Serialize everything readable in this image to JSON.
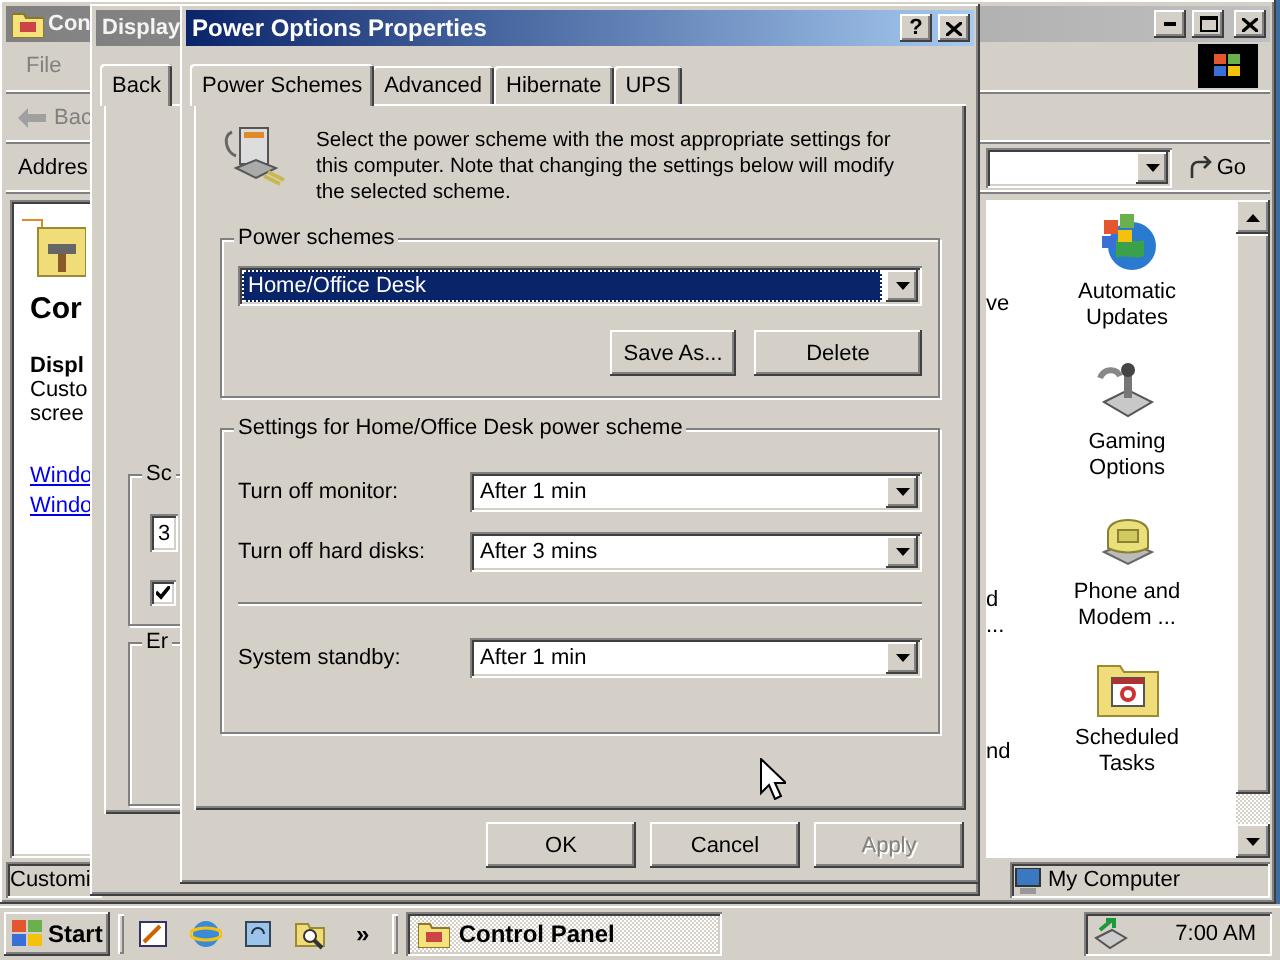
{
  "control_panel": {
    "title": "Con",
    "menu": [
      "File"
    ],
    "back": "Bac",
    "address_label": "Addres",
    "go": "Go",
    "heading": "Cor",
    "info_title": "Displ",
    "info_lines": [
      "Custo",
      "scree"
    ],
    "links": [
      "Windo",
      "Windo"
    ],
    "partial_labels": [
      "ve",
      "d",
      "...",
      "nd"
    ],
    "icons": [
      {
        "kind": "updates",
        "label": "Automatic Updates"
      },
      {
        "kind": "gaming",
        "label": "Gaming Options"
      },
      {
        "kind": "phone",
        "label": "Phone and Modem ..."
      },
      {
        "kind": "tasks",
        "label": "Scheduled Tasks"
      }
    ],
    "status_left": "Customi",
    "status_zone": "My Computer"
  },
  "display_dialog": {
    "title": "Display",
    "tab": "Back",
    "group_1": "Sc",
    "field_value": "3",
    "checked": true,
    "group_2": "Er"
  },
  "power_dialog": {
    "title": "Power Options Properties",
    "help": "?",
    "tabs": [
      {
        "label": "Power Schemes",
        "selected": true
      },
      {
        "label": "Advanced",
        "selected": false
      },
      {
        "label": "Hibernate",
        "selected": false
      },
      {
        "label": "UPS",
        "selected": false
      }
    ],
    "description": "Select the power scheme with the most appropriate settings for this computer. Note that changing the settings below will modify the selected scheme.",
    "schemes_label": "Power schemes",
    "scheme": "Home/Office Desk",
    "scheme_buttons": [
      "Save As...",
      "Delete"
    ],
    "settings_label": "Settings for Home/Office Desk power scheme",
    "rows": [
      {
        "kind": "setting",
        "label": "Turn off monitor:",
        "value": "After 1 min"
      },
      {
        "kind": "setting",
        "label": "Turn off hard disks:",
        "value": "After 3 mins"
      },
      {
        "kind": "separator"
      },
      {
        "kind": "setting",
        "label": "System standby:",
        "value": "After 1 min"
      }
    ],
    "buttons": [
      {
        "label": "OK",
        "disabled": false
      },
      {
        "label": "Cancel",
        "disabled": false
      },
      {
        "label": "Apply",
        "disabled": true
      }
    ]
  },
  "taskbar": {
    "start": "Start",
    "chevron": "»",
    "tasks": [
      {
        "label": "Control Panel",
        "selected": true
      }
    ],
    "clock": "7:00 AM"
  }
}
